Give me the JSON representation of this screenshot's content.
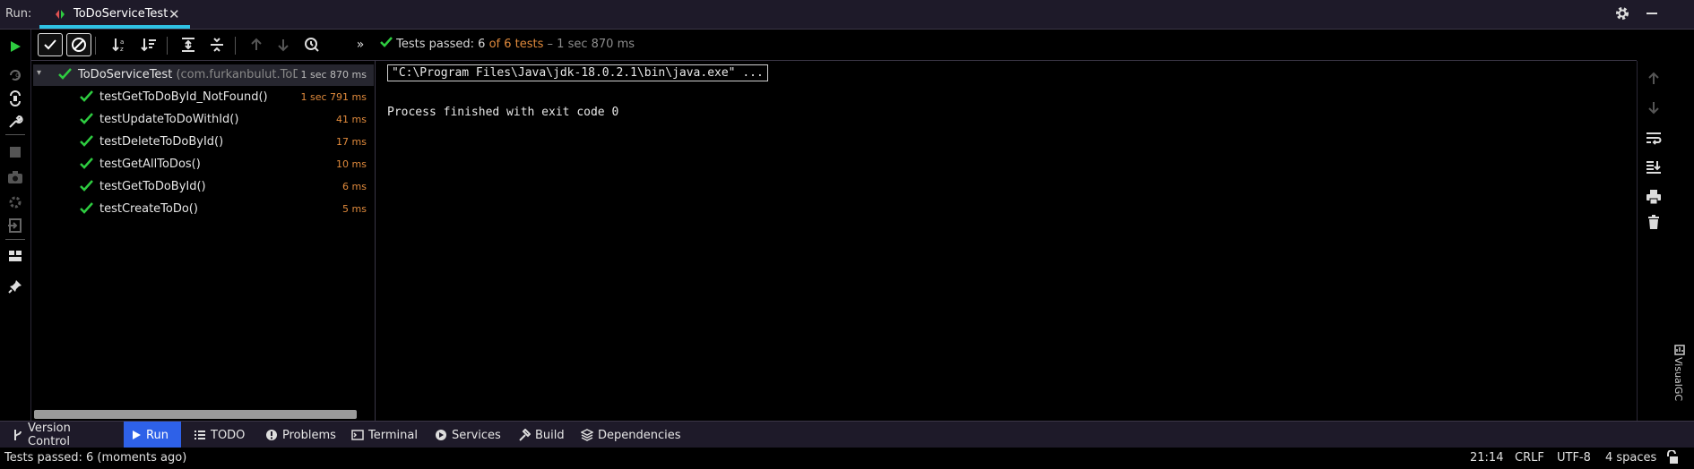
{
  "titlebar": {
    "run_label": "Run:",
    "tab_title": "ToDoServiceTest",
    "tab_close": "✕"
  },
  "status_header": {
    "passed": "Tests passed: 6",
    "of_total": "of 6 tests",
    "duration": "– 1 sec 870 ms"
  },
  "tree": {
    "root": {
      "name": "ToDoServiceTest",
      "package": "(com.furkanbulut.ToDoAp",
      "time": "1 sec 870 ms"
    },
    "tests": [
      {
        "name": "testGetToDoById_NotFound()",
        "time": "1 sec 791 ms"
      },
      {
        "name": "testUpdateToDoWithId()",
        "time": "41 ms"
      },
      {
        "name": "testDeleteToDoById()",
        "time": "17 ms"
      },
      {
        "name": "testGetAllToDos()",
        "time": "10 ms"
      },
      {
        "name": "testGetToDoById()",
        "time": "6 ms"
      },
      {
        "name": "testCreateToDo()",
        "time": "5 ms"
      }
    ]
  },
  "console": {
    "command": "\"C:\\Program Files\\Java\\jdk-18.0.2.1\\bin\\java.exe\" ...",
    "exit_message": "Process finished with exit code 0"
  },
  "visualgc_label": "VisualGC",
  "tool_tabs": [
    {
      "label": "Version Control",
      "icon": "branch-icon"
    },
    {
      "label": "Run",
      "icon": "run-icon"
    },
    {
      "label": "TODO",
      "icon": "list-icon"
    },
    {
      "label": "Problems",
      "icon": "info-icon"
    },
    {
      "label": "Terminal",
      "icon": "terminal-icon"
    },
    {
      "label": "Services",
      "icon": "services-icon"
    },
    {
      "label": "Build",
      "icon": "hammer-icon"
    },
    {
      "label": "Dependencies",
      "icon": "layers-icon"
    }
  ],
  "statusbar": {
    "message": "Tests passed: 6 (moments ago)",
    "position": "21:14",
    "line_ending": "CRLF",
    "encoding": "UTF-8",
    "indent": "4 spaces"
  },
  "colors": {
    "accent": "#2fc3e5",
    "pass_green": "#2ecc40",
    "duration_orange": "#e08a3c",
    "active_tab": "#2e61e8"
  }
}
